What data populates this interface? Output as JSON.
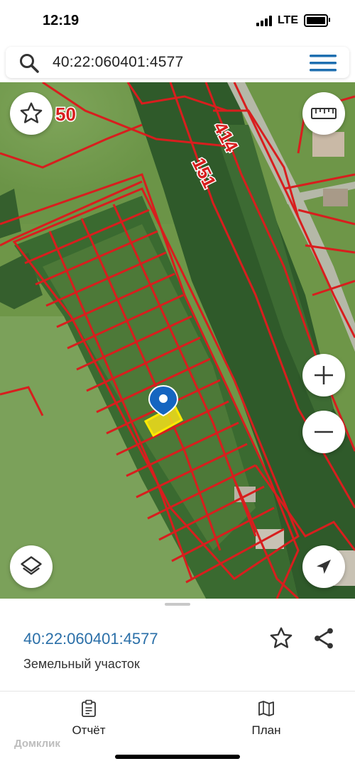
{
  "status_bar": {
    "time": "12:19",
    "network": "LTE"
  },
  "search": {
    "query": "40:22:060401:4577"
  },
  "map": {
    "labels": [
      "50",
      "414",
      "151"
    ],
    "colors": {
      "boundary": "#d81e1e",
      "selected_fill": "#f2de1a",
      "pin": "#1565c0"
    }
  },
  "icons": {
    "search": "search-icon",
    "menu": "hamburger-menu-icon",
    "favorite": "star-icon",
    "ruler": "ruler-icon",
    "zoom_in": "plus-icon",
    "zoom_out": "minus-icon",
    "layers": "layers-icon",
    "locate": "navigation-arrow-icon",
    "share": "share-icon",
    "report": "clipboard-icon",
    "plan": "map-icon"
  },
  "parcel": {
    "cadastral_number": "40:22:060401:4577",
    "type": "Земельный участок"
  },
  "tabs": [
    {
      "label": "Отчёт"
    },
    {
      "label": "План"
    }
  ],
  "watermark": "Домклик"
}
